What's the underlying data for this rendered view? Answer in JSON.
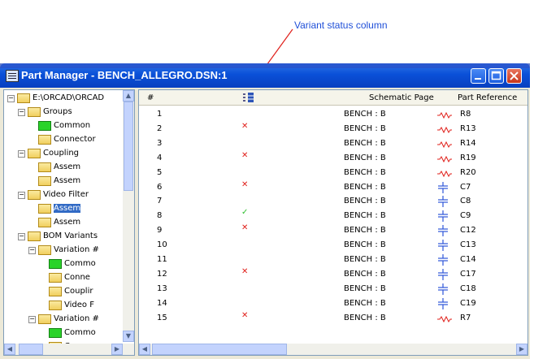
{
  "annotation": {
    "label": "Variant status column"
  },
  "window": {
    "title": "Part Manager - BENCH_ALLEGRO.DSN:1"
  },
  "tree": [
    {
      "label": "E:\\ORCAD\\ORCAD",
      "expander": "−",
      "folder": "yellow"
    },
    {
      "label": "Groups",
      "expander": "−",
      "folder": "yellow"
    },
    {
      "label": "Common",
      "expander": "",
      "folder": "green"
    },
    {
      "label": "Connector",
      "expander": "",
      "folder": "yellow"
    },
    {
      "label": "Coupling",
      "expander": "−",
      "folder": "yellow"
    },
    {
      "label": "Assem",
      "expander": "",
      "folder": "yellow"
    },
    {
      "label": "Assem",
      "expander": "",
      "folder": "yellow"
    },
    {
      "label": "Video Filter",
      "expander": "−",
      "folder": "yellow"
    },
    {
      "label": "Assem",
      "expander": "",
      "folder": "yellow",
      "selected": true
    },
    {
      "label": "Assem",
      "expander": "",
      "folder": "yellow"
    },
    {
      "label": "BOM Variants",
      "expander": "−",
      "folder": "yellow"
    },
    {
      "label": "Variation #",
      "expander": "−",
      "folder": "yellow"
    },
    {
      "label": "Commo",
      "expander": "",
      "folder": "green"
    },
    {
      "label": "Conne",
      "expander": "",
      "folder": "yellow"
    },
    {
      "label": "Couplir",
      "expander": "",
      "folder": "yellow"
    },
    {
      "label": "Video F",
      "expander": "",
      "folder": "yellow"
    },
    {
      "label": "Variation #",
      "expander": "−",
      "folder": "yellow"
    },
    {
      "label": "Commo",
      "expander": "",
      "folder": "green"
    },
    {
      "label": "Conne",
      "expander": "",
      "folder": "yellow"
    }
  ],
  "table": {
    "columns": {
      "num": "#",
      "page": "Schematic Page",
      "ref": "Part Reference"
    },
    "rows": [
      {
        "num": "1",
        "status": "",
        "page": "BENCH : B",
        "ref": "R8",
        "type": "resistor"
      },
      {
        "num": "2",
        "status": "x",
        "page": "BENCH : B",
        "ref": "R13",
        "type": "resistor"
      },
      {
        "num": "3",
        "status": "",
        "page": "BENCH : B",
        "ref": "R14",
        "type": "resistor"
      },
      {
        "num": "4",
        "status": "x",
        "page": "BENCH : B",
        "ref": "R19",
        "type": "resistor"
      },
      {
        "num": "5",
        "status": "",
        "page": "BENCH : B",
        "ref": "R20",
        "type": "resistor"
      },
      {
        "num": "6",
        "status": "x",
        "page": "BENCH : B",
        "ref": "C7",
        "type": "capacitor"
      },
      {
        "num": "7",
        "status": "",
        "page": "BENCH : B",
        "ref": "C8",
        "type": "capacitor"
      },
      {
        "num": "8",
        "status": "ok",
        "page": "BENCH : B",
        "ref": "C9",
        "type": "capacitor"
      },
      {
        "num": "9",
        "status": "x",
        "page": "BENCH : B",
        "ref": "C12",
        "type": "capacitor"
      },
      {
        "num": "10",
        "status": "",
        "page": "BENCH : B",
        "ref": "C13",
        "type": "capacitor"
      },
      {
        "num": "11",
        "status": "",
        "page": "BENCH : B",
        "ref": "C14",
        "type": "capacitor"
      },
      {
        "num": "12",
        "status": "x",
        "page": "BENCH : B",
        "ref": "C17",
        "type": "capacitor"
      },
      {
        "num": "13",
        "status": "",
        "page": "BENCH : B",
        "ref": "C18",
        "type": "capacitor"
      },
      {
        "num": "14",
        "status": "",
        "page": "BENCH : B",
        "ref": "C19",
        "type": "capacitor"
      },
      {
        "num": "15",
        "status": "x",
        "page": "BENCH : B",
        "ref": "R7",
        "type": "resistor"
      }
    ]
  },
  "status_marks": {
    "x": "✕",
    "ok": "✓"
  },
  "colors": {
    "accent": "#0a50d8",
    "error": "#e0201b",
    "ok": "#2fbf2f",
    "annotation": "#1f4fd8"
  }
}
